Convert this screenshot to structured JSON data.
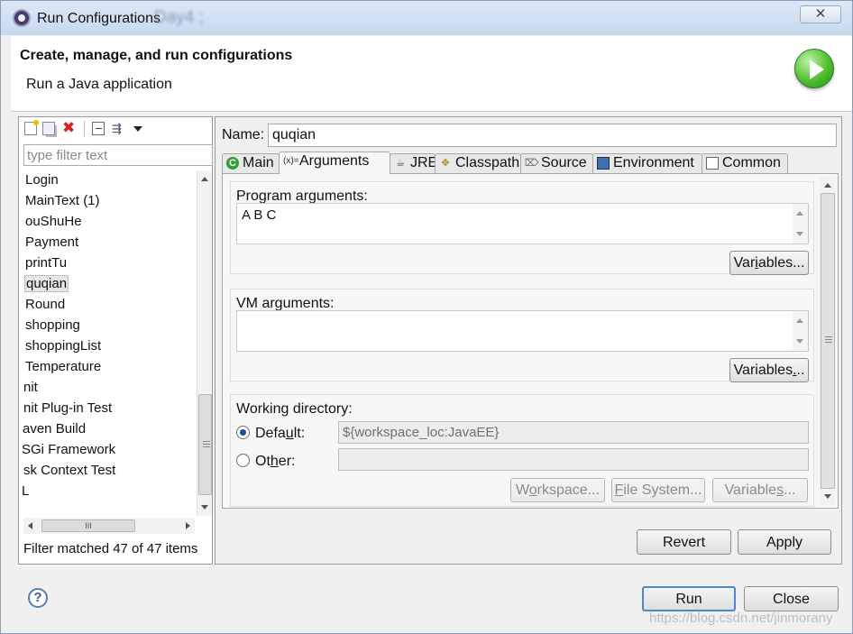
{
  "window": {
    "title": "Run Configurations",
    "title_background_text": "Day4 ;",
    "close_label": "✕"
  },
  "header": {
    "title": "Create, manage, and run configurations",
    "subtitle": "Run a Java application"
  },
  "left_panel": {
    "filter_placeholder": "type filter text",
    "tree_items": [
      "Login",
      "MainText (1)",
      "ouShuHe",
      "Payment",
      "printTu",
      "quqian",
      "Round",
      "shopping",
      "shoppingList",
      "Temperature",
      "nit",
      "nit Plug-in Test",
      "aven Build",
      "SGi Framework",
      "sk Context Test",
      "L"
    ],
    "selected_item": "quqian",
    "status": "Filter matched 47 of 47 items",
    "hscroll_grip": "III"
  },
  "config": {
    "name_label": "Name:",
    "name_value": "quqian",
    "tabs": [
      {
        "label": "Main",
        "icon": "main-class-icon"
      },
      {
        "label": "Arguments",
        "icon": "arguments-icon"
      },
      {
        "label": "JRE",
        "icon": "jre-icon"
      },
      {
        "label": "Classpath",
        "icon": "classpath-icon"
      },
      {
        "label": "Source",
        "icon": "source-icon"
      },
      {
        "label": "Environment",
        "icon": "environment-icon"
      },
      {
        "label": "Common",
        "icon": "common-icon"
      }
    ],
    "active_tab": "Arguments",
    "args_icon_glyph": "(x)=",
    "program_arguments": {
      "label": "Program arguments:",
      "value": "A B C",
      "button_pre": "Var",
      "button_mnemonic": "i",
      "button_post": "ables..."
    },
    "vm_arguments": {
      "label": "VM arguments:",
      "value": "",
      "button_pre": "Variables",
      "button_mnemonic": ".",
      "button_post": ".."
    },
    "working_directory": {
      "label": "Working directory:",
      "default_pre": "Defa",
      "default_mnemonic": "u",
      "default_post": "lt:",
      "default_value": "${workspace_loc:JavaEE}",
      "other_pre": "Ot",
      "other_mnemonic": "h",
      "other_post": "er:",
      "other_value": "",
      "selected": "default",
      "buttons": {
        "workspace_pre": "W",
        "workspace_mnemonic": "o",
        "workspace_post": "rkspace...",
        "filesystem_pre": "",
        "filesystem_mnemonic": "F",
        "filesystem_post": "ile System...",
        "variables_pre": "Variable",
        "variables_mnemonic": "s",
        "variables_post": "..."
      }
    },
    "revert_label": "Revert",
    "apply_label": "Apply"
  },
  "footer": {
    "run_label": "Run",
    "close_label": "Close",
    "help_glyph": "?",
    "watermark": "https://blog.csdn.net/jinmorany"
  },
  "colors": {
    "run_icon": "#4fbf2f",
    "delete_icon": "#d62020",
    "radio_selected": "#1c4f9c",
    "title_bar": "#c7d9ee"
  }
}
